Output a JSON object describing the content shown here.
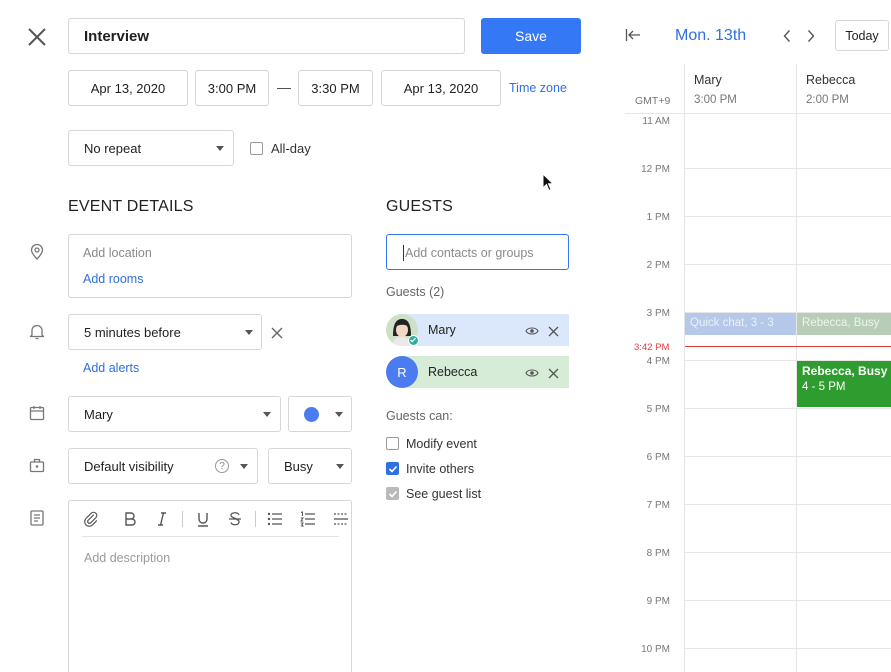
{
  "editor": {
    "title_value": "Interview",
    "save_label": "Save",
    "start_date": "Apr 13, 2020",
    "start_time": "3:00 PM",
    "dash": "—",
    "end_time": "3:30 PM",
    "end_date": "Apr 13, 2020",
    "timezone_label": "Time zone",
    "repeat_value": "No repeat",
    "allday_label": "All-day",
    "event_details_heading": "EVENT DETAILS",
    "location_placeholder": "Add location",
    "add_rooms_label": "Add rooms",
    "alert_value": "5 minutes before",
    "add_alerts_label": "Add alerts",
    "calendar_value": "Mary",
    "calendar_color": "#4a7cf0",
    "visibility_value": "Default visibility",
    "help_glyph": "?",
    "busy_value": "Busy",
    "description_placeholder": "Add description",
    "toolbar_icons": [
      "attach-icon",
      "bold-icon",
      "italic-icon",
      "underline-icon",
      "strikethrough-icon",
      "bullet-list-icon",
      "numbered-list-icon",
      "divider-icon"
    ]
  },
  "guests": {
    "heading": "GUESTS",
    "input_placeholder": "Add contacts or groups",
    "count_label": "Guests (2)",
    "list": [
      {
        "name": "Mary",
        "initial": "",
        "bg": "#dbe7fb",
        "avatar_color": "#c9d8c0"
      },
      {
        "name": "Rebecca",
        "initial": "R",
        "bg": "#d6ecd6",
        "avatar_color": "#4a7cf0"
      }
    ],
    "can_label": "Guests can:",
    "permissions": [
      {
        "label": "Modify event",
        "checked": false
      },
      {
        "label": "Invite others",
        "checked": true
      },
      {
        "label": "See guest list",
        "checked": true
      }
    ]
  },
  "calendar": {
    "date_label": "Mon. 13th",
    "today_label": "Today",
    "timezone": "GMT+9",
    "columns": [
      {
        "name": "Mary",
        "time": "3:00 PM"
      },
      {
        "name": "Rebecca",
        "time": "2:00 PM"
      }
    ],
    "hours": [
      "11 AM",
      "12 PM",
      "1 PM",
      "2 PM",
      "3 PM",
      "4 PM",
      "5 PM",
      "6 PM",
      "7 PM",
      "8 PM",
      "9 PM",
      "10 PM"
    ],
    "now_label": "3:42 PM",
    "events": [
      {
        "title": "Quick chat, 3 - 3",
        "column": "Mary"
      },
      {
        "title": "Rebecca, Busy",
        "column": "Rebecca"
      },
      {
        "title": "Rebecca, Busy",
        "subtitle": "4 - 5 PM",
        "column": "Rebecca"
      }
    ],
    "accent_color": "#2f6fe0",
    "busy_color": "#2e9c2e"
  }
}
